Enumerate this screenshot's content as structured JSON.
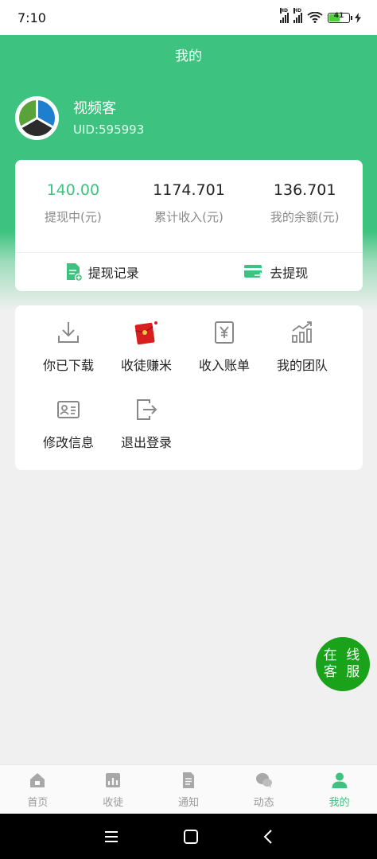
{
  "status_bar": {
    "time": "7:10",
    "battery": "41",
    "hd": "HD"
  },
  "header": {
    "title": "我的"
  },
  "profile": {
    "name": "视频客",
    "uid": "UID:595993"
  },
  "stats": [
    {
      "value": "140.00",
      "label": "提现中(元)"
    },
    {
      "value": "1174.701",
      "label": "累计收入(元)"
    },
    {
      "value": "136.701",
      "label": "我的余额(元)"
    }
  ],
  "actions": {
    "withdraw_records": "提现记录",
    "withdraw": "去提现"
  },
  "menu": [
    {
      "label": "你已下载",
      "icon": "download-icon"
    },
    {
      "label": "收徒赚米",
      "icon": "red-envelope-icon"
    },
    {
      "label": "收入账单",
      "icon": "yuan-bill-icon"
    },
    {
      "label": "我的团队",
      "icon": "bar-chart-icon"
    },
    {
      "label": "修改信息",
      "icon": "id-card-icon"
    },
    {
      "label": "退出登录",
      "icon": "logout-icon"
    }
  ],
  "customer_service": {
    "line1": "在 线",
    "line2": "客 服"
  },
  "tabs": [
    {
      "label": "首页",
      "icon": "home-icon"
    },
    {
      "label": "收徒",
      "icon": "apprentice-icon"
    },
    {
      "label": "通知",
      "icon": "notice-icon"
    },
    {
      "label": "动态",
      "icon": "chat-icon"
    },
    {
      "label": "我的",
      "icon": "user-icon",
      "active": true
    }
  ],
  "colors": {
    "brand": "#3ec27f",
    "service_button": "#1aa31a"
  }
}
